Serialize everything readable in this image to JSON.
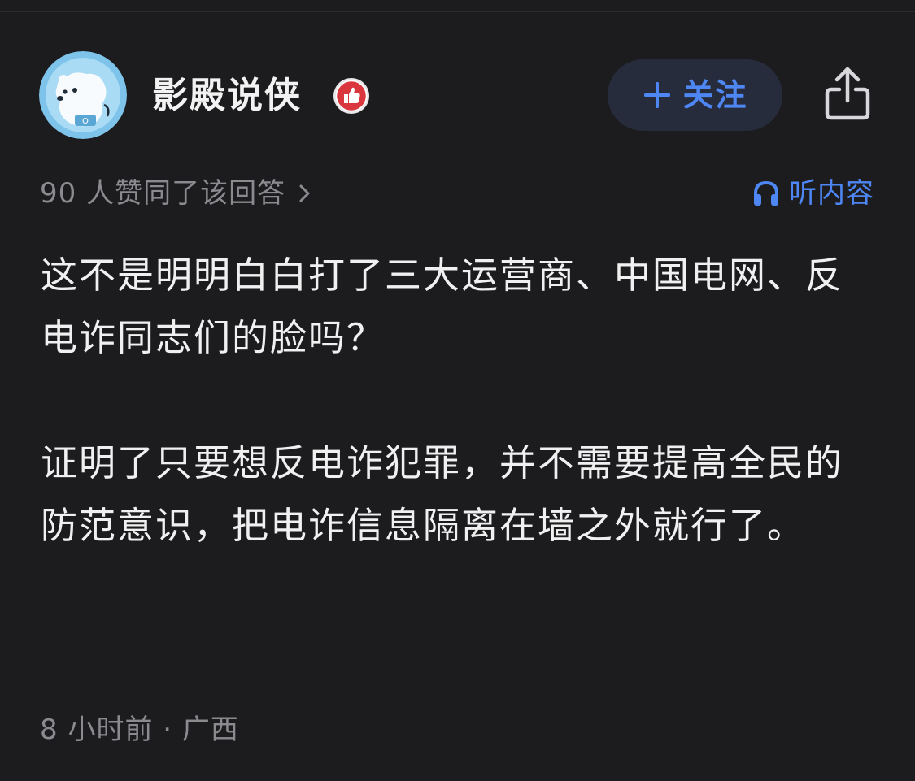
{
  "author": {
    "name": "影殿说侠",
    "avatar_icon": "polar-bear-avatar",
    "badge_icon": "thumbs-up-badge-icon"
  },
  "follow_button": {
    "label": "关注",
    "icon": "plus-icon"
  },
  "share_button": {
    "icon": "share-icon"
  },
  "upvote_summary": {
    "text": "90 人赞同了该回答"
  },
  "listen": {
    "label": "听内容",
    "icon": "headphones-icon"
  },
  "answer": {
    "paragraphs": [
      "这不是明明白白打了三大运营商、中国电网、反电诈同志们的脸吗？",
      "证明了只要想反电诈犯罪，并不需要提高全民的防范意识，把电诈信息隔离在墙之外就行了。"
    ]
  },
  "meta": {
    "time": "8 小时前",
    "separator": "·",
    "location": "广西"
  },
  "colors": {
    "background": "#1c1c1f",
    "accent": "#4e86f4",
    "text_primary": "#f0f0f0",
    "text_secondary": "#8a8a8f",
    "follow_bg": "#262c3b"
  }
}
